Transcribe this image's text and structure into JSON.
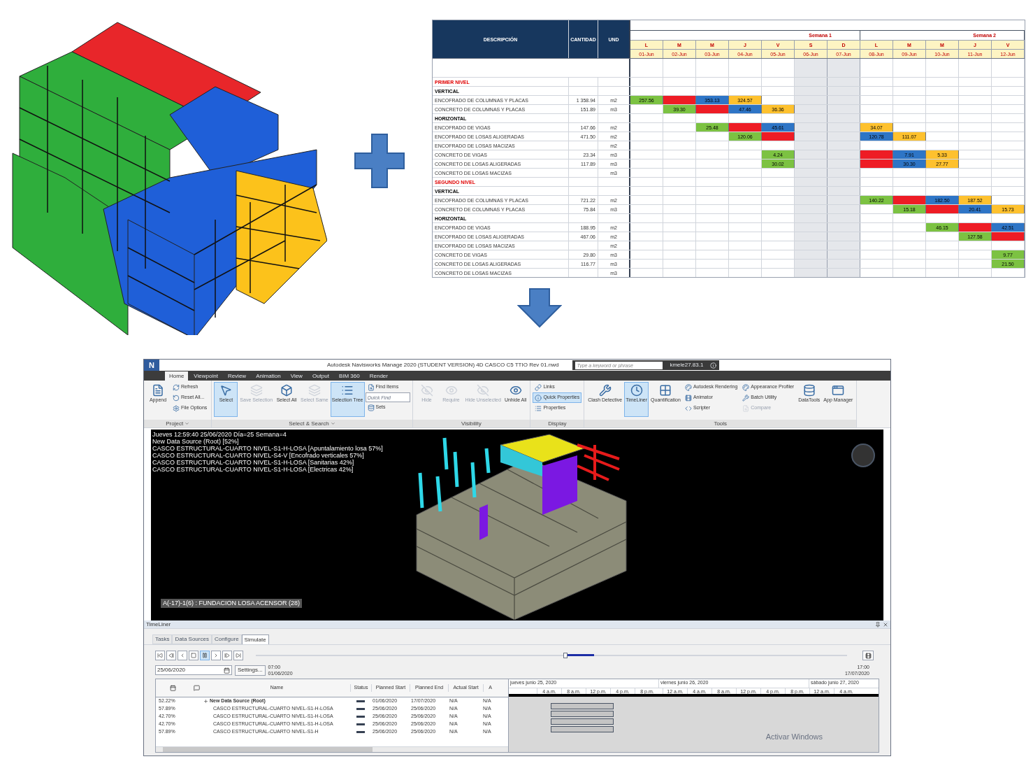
{
  "sheet": {
    "columns": [
      "DESCRIPCIÓN",
      "CANTIDAD",
      "UND"
    ],
    "weeks": [
      {
        "label": "Semana 1",
        "days": [
          {
            "letter": "L",
            "date": "01-Jun",
            "weekend": false
          },
          {
            "letter": "M",
            "date": "02-Jun",
            "weekend": false
          },
          {
            "letter": "M",
            "date": "03-Jun",
            "weekend": false
          },
          {
            "letter": "J",
            "date": "04-Jun",
            "weekend": false
          },
          {
            "letter": "V",
            "date": "05-Jun",
            "weekend": false
          },
          {
            "letter": "S",
            "date": "06-Jun",
            "weekend": true
          },
          {
            "letter": "D",
            "date": "07-Jun",
            "weekend": true
          }
        ]
      },
      {
        "label": "Semana 2",
        "days": [
          {
            "letter": "L",
            "date": "08-Jun",
            "weekend": false
          },
          {
            "letter": "M",
            "date": "09-Jun",
            "weekend": false
          },
          {
            "letter": "M",
            "date": "10-Jun",
            "weekend": false
          },
          {
            "letter": "J",
            "date": "11-Jun",
            "weekend": false
          },
          {
            "letter": "V",
            "date": "12-Jun",
            "weekend": false
          }
        ]
      }
    ],
    "rows": [
      {
        "kind": "section",
        "text": "PRIMER NIVEL"
      },
      {
        "kind": "group",
        "text": "VERTICAL"
      },
      {
        "kind": "item",
        "text": "ENCOFRADO DE COLUMNAS Y PLACAS",
        "qty": "1 358.94",
        "unit": "m2",
        "days": [
          {
            "kind": "filled",
            "color": "#7cc242",
            "value": "257.56"
          },
          {
            "kind": "filled",
            "color": "#ee1c25"
          },
          {
            "kind": "filled",
            "color": "#2e75c6",
            "value": "353.13"
          },
          {
            "kind": "filled",
            "color": "#fec12e",
            "value": "324.57"
          },
          {
            "kind": "blank"
          },
          {
            "kind": "blank"
          },
          {
            "kind": "blank"
          },
          {
            "kind": "blank"
          },
          {
            "kind": "blank"
          },
          {
            "kind": "blank"
          },
          {
            "kind": "blank"
          },
          {
            "kind": "blank"
          }
        ]
      },
      {
        "kind": "item",
        "text": "CONCRETO DE COLUMNAS Y PLACAS",
        "qty": "151.89",
        "unit": "m3",
        "days": [
          {
            "kind": "blank"
          },
          {
            "kind": "filled",
            "color": "#7cc242",
            "value": "39.30"
          },
          {
            "kind": "filled",
            "color": "#ee1c25"
          },
          {
            "kind": "filled",
            "color": "#2e75c6",
            "value": "47.46"
          },
          {
            "kind": "filled",
            "color": "#fec12e",
            "value": "36.36"
          },
          {
            "kind": "blank"
          },
          {
            "kind": "blank"
          },
          {
            "kind": "blank"
          },
          {
            "kind": "blank"
          },
          {
            "kind": "blank"
          },
          {
            "kind": "blank"
          },
          {
            "kind": "blank"
          }
        ]
      },
      {
        "kind": "group",
        "text": "HORIZONTAL"
      },
      {
        "kind": "item",
        "text": "ENCOFRADO DE VIGAS",
        "qty": "147.66",
        "unit": "m2",
        "days": [
          {
            "kind": "blank"
          },
          {
            "kind": "blank"
          },
          {
            "kind": "filled",
            "color": "#7cc242",
            "value": "25.48"
          },
          {
            "kind": "filled",
            "color": "#ee1c25"
          },
          {
            "kind": "filled",
            "color": "#2e75c6",
            "value": "45.61"
          },
          {
            "kind": "blank"
          },
          {
            "kind": "blank"
          },
          {
            "kind": "filled",
            "color": "#fec12e",
            "value": "34.07"
          },
          {
            "kind": "blank"
          },
          {
            "kind": "blank"
          },
          {
            "kind": "blank"
          },
          {
            "kind": "blank"
          }
        ]
      },
      {
        "kind": "item",
        "text": "ENCOFRADO DE LOSAS ALIGERADAS",
        "qty": "471.50",
        "unit": "m2",
        "days": [
          {
            "kind": "blank"
          },
          {
            "kind": "blank"
          },
          {
            "kind": "blank"
          },
          {
            "kind": "filled",
            "color": "#7cc242",
            "value": "120.06"
          },
          {
            "kind": "filled",
            "color": "#ee1c25"
          },
          {
            "kind": "blank"
          },
          {
            "kind": "blank"
          },
          {
            "kind": "filled",
            "color": "#2e75c6",
            "value": "120.78"
          },
          {
            "kind": "filled",
            "color": "#fec12e",
            "value": "111.07"
          },
          {
            "kind": "blank"
          },
          {
            "kind": "blank"
          },
          {
            "kind": "blank"
          }
        ]
      },
      {
        "kind": "item",
        "text": "ENCOFRADO DE LOSAS MACIZAS",
        "unit": "m2",
        "days": [
          {
            "kind": "blank"
          },
          {
            "kind": "blank"
          },
          {
            "kind": "blank"
          },
          {
            "kind": "blank"
          },
          {
            "kind": "blank"
          },
          {
            "kind": "blank"
          },
          {
            "kind": "blank"
          },
          {
            "kind": "blank"
          },
          {
            "kind": "blank"
          },
          {
            "kind": "blank"
          },
          {
            "kind": "blank"
          },
          {
            "kind": "blank"
          }
        ]
      },
      {
        "kind": "item",
        "text": "CONCRETO DE VIGAS",
        "qty": "23.34",
        "unit": "m3",
        "days": [
          {
            "kind": "blank"
          },
          {
            "kind": "blank"
          },
          {
            "kind": "blank"
          },
          {
            "kind": "blank"
          },
          {
            "kind": "filled",
            "color": "#7cc242",
            "value": "4.24"
          },
          {
            "kind": "blank"
          },
          {
            "kind": "blank"
          },
          {
            "kind": "filled",
            "color": "#ee1c25"
          },
          {
            "kind": "filled",
            "color": "#2e75c6",
            "value": "7.91"
          },
          {
            "kind": "filled",
            "color": "#fec12e",
            "value": "5.33"
          },
          {
            "kind": "blank"
          },
          {
            "kind": "blank"
          }
        ]
      },
      {
        "kind": "item",
        "text": "CONCRETO DE LOSAS ALIGERADAS",
        "qty": "117.89",
        "unit": "m3",
        "days": [
          {
            "kind": "blank"
          },
          {
            "kind": "blank"
          },
          {
            "kind": "blank"
          },
          {
            "kind": "blank"
          },
          {
            "kind": "filled",
            "color": "#7cc242",
            "value": "30.02"
          },
          {
            "kind": "blank"
          },
          {
            "kind": "blank"
          },
          {
            "kind": "filled",
            "color": "#ee1c25"
          },
          {
            "kind": "filled",
            "color": "#2e75c6",
            "value": "30.30"
          },
          {
            "kind": "filled",
            "color": "#fec12e",
            "value": "27.77"
          },
          {
            "kind": "blank"
          },
          {
            "kind": "blank"
          }
        ]
      },
      {
        "kind": "item",
        "text": "CONCRETO DE LOSAS MACIZAS",
        "unit": "m3",
        "days": [
          {
            "kind": "blank"
          },
          {
            "kind": "blank"
          },
          {
            "kind": "blank"
          },
          {
            "kind": "blank"
          },
          {
            "kind": "blank"
          },
          {
            "kind": "blank"
          },
          {
            "kind": "blank"
          },
          {
            "kind": "blank"
          },
          {
            "kind": "blank"
          },
          {
            "kind": "blank"
          },
          {
            "kind": "blank"
          },
          {
            "kind": "blank"
          }
        ]
      },
      {
        "kind": "section",
        "text": "SEGUNDO NIVEL"
      },
      {
        "kind": "group",
        "text": "VERTICAL"
      },
      {
        "kind": "item",
        "text": "ENCOFRADO DE COLUMNAS Y PLACAS",
        "qty": "721.22",
        "unit": "m2",
        "days": [
          {
            "kind": "blank"
          },
          {
            "kind": "blank"
          },
          {
            "kind": "blank"
          },
          {
            "kind": "blank"
          },
          {
            "kind": "blank"
          },
          {
            "kind": "blank"
          },
          {
            "kind": "blank"
          },
          {
            "kind": "filled",
            "color": "#7cc242",
            "value": "140.22"
          },
          {
            "kind": "filled",
            "color": "#ee1c25"
          },
          {
            "kind": "filled",
            "color": "#2e75c6",
            "value": "182.50"
          },
          {
            "kind": "filled",
            "color": "#fec12e",
            "value": "187.52"
          },
          {
            "kind": "blank"
          }
        ]
      },
      {
        "kind": "item",
        "text": "CONCRETO DE COLUMNAS Y PLACAS",
        "qty": "75.84",
        "unit": "m3",
        "days": [
          {
            "kind": "blank"
          },
          {
            "kind": "blank"
          },
          {
            "kind": "blank"
          },
          {
            "kind": "blank"
          },
          {
            "kind": "blank"
          },
          {
            "kind": "blank"
          },
          {
            "kind": "blank"
          },
          {
            "kind": "blank"
          },
          {
            "kind": "filled",
            "color": "#7cc242",
            "value": "15.18"
          },
          {
            "kind": "filled",
            "color": "#ee1c25"
          },
          {
            "kind": "filled",
            "color": "#2e75c6",
            "value": "20.41"
          },
          {
            "kind": "filled",
            "color": "#fec12e",
            "value": "15.73"
          }
        ]
      },
      {
        "kind": "group",
        "text": "HORIZONTAL"
      },
      {
        "kind": "item",
        "text": "ENCOFRADO DE VIGAS",
        "qty": "188.95",
        "unit": "m2",
        "days": [
          {
            "kind": "blank"
          },
          {
            "kind": "blank"
          },
          {
            "kind": "blank"
          },
          {
            "kind": "blank"
          },
          {
            "kind": "blank"
          },
          {
            "kind": "blank"
          },
          {
            "kind": "blank"
          },
          {
            "kind": "blank"
          },
          {
            "kind": "blank"
          },
          {
            "kind": "filled",
            "color": "#7cc242",
            "value": "46.15"
          },
          {
            "kind": "filled",
            "color": "#ee1c25"
          },
          {
            "kind": "filled",
            "color": "#2e75c6",
            "value": "42.51"
          }
        ]
      },
      {
        "kind": "item",
        "text": "ENCOFRADO DE LOSAS ALIGERADAS",
        "qty": "467.06",
        "unit": "m2",
        "days": [
          {
            "kind": "blank"
          },
          {
            "kind": "blank"
          },
          {
            "kind": "blank"
          },
          {
            "kind": "blank"
          },
          {
            "kind": "blank"
          },
          {
            "kind": "blank"
          },
          {
            "kind": "blank"
          },
          {
            "kind": "blank"
          },
          {
            "kind": "blank"
          },
          {
            "kind": "blank"
          },
          {
            "kind": "filled",
            "color": "#7cc242",
            "value": "127.58"
          },
          {
            "kind": "filled",
            "color": "#ee1c25"
          }
        ]
      },
      {
        "kind": "item",
        "text": "ENCOFRADO DE LOSAS MACIZAS",
        "unit": "m2",
        "days": [
          {
            "kind": "blank"
          },
          {
            "kind": "blank"
          },
          {
            "kind": "blank"
          },
          {
            "kind": "blank"
          },
          {
            "kind": "blank"
          },
          {
            "kind": "blank"
          },
          {
            "kind": "blank"
          },
          {
            "kind": "blank"
          },
          {
            "kind": "blank"
          },
          {
            "kind": "blank"
          },
          {
            "kind": "blank"
          },
          {
            "kind": "blank"
          }
        ]
      },
      {
        "kind": "item",
        "text": "CONCRETO DE VIGAS",
        "qty": "29.80",
        "unit": "m3",
        "days": [
          {
            "kind": "blank"
          },
          {
            "kind": "blank"
          },
          {
            "kind": "blank"
          },
          {
            "kind": "blank"
          },
          {
            "kind": "blank"
          },
          {
            "kind": "blank"
          },
          {
            "kind": "blank"
          },
          {
            "kind": "blank"
          },
          {
            "kind": "blank"
          },
          {
            "kind": "blank"
          },
          {
            "kind": "blank"
          },
          {
            "kind": "filled",
            "color": "#7cc242",
            "value": "9.77"
          }
        ]
      },
      {
        "kind": "item",
        "text": "CONCRETO DE LOSAS ALIGERADAS",
        "qty": "116.77",
        "unit": "m3",
        "days": [
          {
            "kind": "blank"
          },
          {
            "kind": "blank"
          },
          {
            "kind": "blank"
          },
          {
            "kind": "blank"
          },
          {
            "kind": "blank"
          },
          {
            "kind": "blank"
          },
          {
            "kind": "blank"
          },
          {
            "kind": "blank"
          },
          {
            "kind": "blank"
          },
          {
            "kind": "blank"
          },
          {
            "kind": "blank"
          },
          {
            "kind": "filled",
            "color": "#7cc242",
            "value": "21.50"
          }
        ]
      },
      {
        "kind": "item",
        "text": "CONCRETO DE LOSAS MACIZAS",
        "unit": "m3",
        "days": [
          {
            "kind": "blank"
          },
          {
            "kind": "blank"
          },
          {
            "kind": "blank"
          },
          {
            "kind": "blank"
          },
          {
            "kind": "blank"
          },
          {
            "kind": "blank"
          },
          {
            "kind": "blank"
          },
          {
            "kind": "blank"
          },
          {
            "kind": "blank"
          },
          {
            "kind": "blank"
          },
          {
            "kind": "blank"
          },
          {
            "kind": "blank"
          }
        ]
      }
    ]
  },
  "app": {
    "logo_text": "N",
    "title": "Autodesk Navisworks Manage 2020 (STUDENT VERSION)    4D CASCO C5 TTIO Rev 01.nwd",
    "search": {
      "placeholder": "Type a keyword or phrase"
    },
    "user": "kmele27.83.1",
    "tabs": [
      {
        "label": "Home",
        "selected": true
      },
      {
        "label": "Viewpoint",
        "selected": false
      },
      {
        "label": "Review",
        "selected": false
      },
      {
        "label": "Animation",
        "selected": false
      },
      {
        "label": "View",
        "selected": false
      },
      {
        "label": "Output",
        "selected": false
      },
      {
        "label": "BIM 360",
        "selected": false
      },
      {
        "label": "Render",
        "selected": false
      }
    ],
    "ribbon_groups": [
      {
        "label": "Project",
        "menu": true,
        "items": [
          {
            "kind": "large",
            "label": "Append",
            "active": false,
            "disabled": false
          },
          {
            "kind": "small",
            "label": "Refresh",
            "active": false,
            "disabled": false
          },
          {
            "kind": "small",
            "label": "Reset All...",
            "active": false,
            "disabled": false
          },
          {
            "kind": "small",
            "label": "File Options",
            "active": false,
            "disabled": false
          }
        ]
      },
      {
        "label": "Select & Search",
        "menu": true,
        "items": [
          {
            "kind": "large",
            "label": "Select",
            "active": true,
            "disabled": false
          },
          {
            "kind": "large",
            "label": "Save Selection",
            "active": false,
            "disabled": true
          },
          {
            "kind": "large",
            "label": "Select All",
            "active": false,
            "disabled": false
          },
          {
            "kind": "large",
            "label": "Select Same",
            "active": false,
            "disabled": true
          },
          {
            "kind": "large",
            "label": "Selection Tree",
            "active": true,
            "disabled": false
          },
          {
            "kind": "small",
            "label": "Find Items",
            "active": false,
            "disabled": false
          },
          {
            "kind": "field",
            "placeholder": "Quick Find",
            "active": false,
            "disabled": false
          },
          {
            "kind": "small",
            "label": "Sets",
            "active": false,
            "disabled": false
          }
        ]
      },
      {
        "label": "Visibility",
        "menu": false,
        "items": [
          {
            "kind": "large",
            "label": "Hide",
            "active": false,
            "disabled": true
          },
          {
            "kind": "large",
            "label": "Require",
            "active": false,
            "disabled": true
          },
          {
            "kind": "large",
            "label": "Hide Unselected",
            "active": false,
            "disabled": true
          },
          {
            "kind": "large",
            "label": "Unhide All",
            "active": false,
            "disabled": false
          }
        ]
      },
      {
        "label": "Display",
        "menu": false,
        "items": [
          {
            "kind": "small",
            "label": "Links",
            "active": false,
            "disabled": false
          },
          {
            "kind": "small",
            "label": "Quick Properties",
            "active": true,
            "disabled": false
          },
          {
            "kind": "small",
            "label": "Properties",
            "active": false,
            "disabled": false
          }
        ]
      },
      {
        "label": "Tools",
        "menu": false,
        "items": [
          {
            "kind": "large",
            "label": "Clash Detective",
            "active": false,
            "disabled": false
          },
          {
            "kind": "large",
            "label": "TimeLiner",
            "active": true,
            "disabled": false
          },
          {
            "kind": "large",
            "label": "Quantification",
            "active": false,
            "disabled": false
          },
          {
            "kind": "small",
            "label": "Autodesk Rendering",
            "active": false,
            "disabled": false
          },
          {
            "kind": "small",
            "label": "Animator",
            "active": false,
            "disabled": false
          },
          {
            "kind": "small",
            "label": "Scripter",
            "active": false,
            "disabled": false
          },
          {
            "kind": "small",
            "label": "Appearance Profiler",
            "active": false,
            "disabled": false
          },
          {
            "kind": "small",
            "label": "Batch Utility",
            "active": false,
            "disabled": false
          },
          {
            "kind": "small",
            "label": "Compare",
            "active": false,
            "disabled": true
          },
          {
            "kind": "large",
            "label": "DataTools",
            "active": false,
            "disabled": false
          },
          {
            "kind": "large",
            "label": "App Manager",
            "active": false,
            "disabled": false
          }
        ]
      }
    ],
    "overlay_lines": [
      "Jueves 12:59:40 25/06/2020 Día=25 Semana=4",
      "New Data Source (Root) [52%]",
      "CASCO ESTRUCTURAL-CUARTO NIVEL-S1-H-LOSA [Apuntalamiento losa 57%]",
      "CASCO ESTRUCTURAL-CUARTO NIVEL-S4-V [Encofrado verticales 57%]",
      "CASCO ESTRUCTURAL-CUARTO NIVEL-S1-H-LOSA [Sanitarias 42%]",
      "CASCO ESTRUCTURAL-CUARTO NIVEL-S1-H-LOSA [Electricas 42%]"
    ],
    "tooltip": "A(-17)-1(6) : FUNDACION LOSA ACENSOR (28)",
    "timeliner": {
      "title": "TimeLiner",
      "tabs": [
        {
          "label": "Tasks",
          "selected": false
        },
        {
          "label": "Data Sources",
          "selected": false
        },
        {
          "label": "Configure",
          "selected": false
        },
        {
          "label": "Simulate",
          "selected": true
        }
      ],
      "slider": {
        "level": 0.52
      },
      "date": "25/06/2020",
      "settings_button": "Settings...",
      "start_time": "07:00",
      "start_date": "01/06/2020",
      "end_time": "17:00",
      "end_date": "17/07/2020",
      "columns": [
        "Name",
        "Status",
        "Planned Start",
        "Planned End",
        "Actual Start",
        "A"
      ],
      "rows": [
        {
          "kind": "summary",
          "percent": "52.22%",
          "name": "New Data Source (Root)",
          "planned_start": "01/06/2020",
          "planned_end": "17/07/2020",
          "actual_start": "N/A",
          "col_a": "N/A"
        },
        {
          "kind": "task",
          "percent": "57.89%",
          "name": "CASCO ESTRUCTURAL-CUARTO NIVEL-S1-H-LOSA",
          "planned_start": "25/06/2020",
          "planned_end": "25/06/2020",
          "actual_start": "N/A",
          "col_a": "N/A"
        },
        {
          "kind": "task",
          "percent": "42.70%",
          "name": "CASCO ESTRUCTURAL-CUARTO NIVEL-S1-H-LOSA",
          "planned_start": "25/06/2020",
          "planned_end": "25/06/2020",
          "actual_start": "N/A",
          "col_a": "N/A"
        },
        {
          "kind": "task",
          "percent": "42.70%",
          "name": "CASCO ESTRUCTURAL-CUARTO NIVEL-S1-H-LOSA",
          "planned_start": "25/06/2020",
          "planned_end": "25/06/2020",
          "actual_start": "N/A",
          "col_a": "N/A"
        },
        {
          "kind": "task",
          "percent": "57.89%",
          "name": "CASCO ESTRUCTURAL-CUARTO NIVEL-S1-H",
          "planned_start": "25/06/2020",
          "planned_end": "25/06/2020",
          "actual_start": "N/A",
          "col_a": "N/A"
        }
      ],
      "gantt_days": [
        "jueves junio 25, 2020",
        "viernes junio 26, 2020",
        "sábado junio 27, 2020"
      ],
      "gantt_hours": [
        [
          "4 a.m.",
          "8 a.m.",
          "12 p.m.",
          "4 p.m.",
          "8 p.m."
        ],
        [
          "12 a.m.",
          "4 a.m.",
          "8 a.m.",
          "12 p.m.",
          "4 p.m.",
          "8 p.m."
        ],
        [
          "12 a.m.",
          "4 a.m."
        ]
      ],
      "activation_notice": "Activar Windows"
    }
  }
}
